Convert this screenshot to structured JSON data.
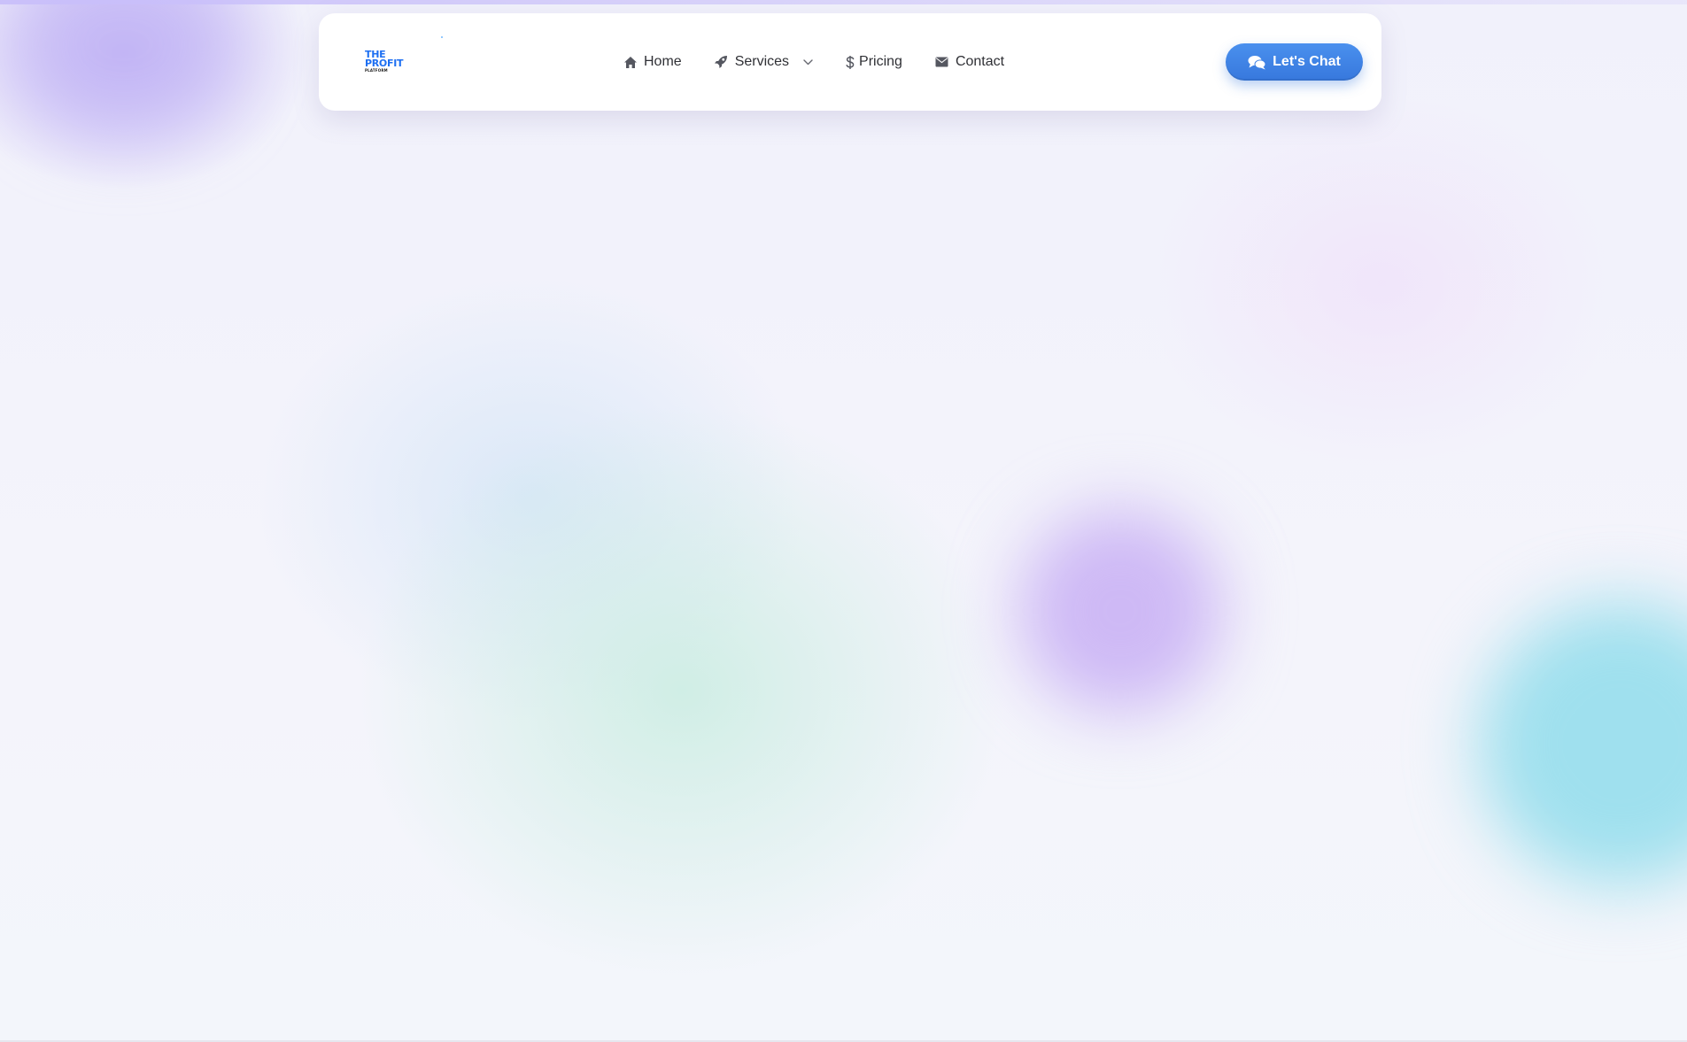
{
  "brand": {
    "logo_line1": "THE",
    "logo_line2": "PROFIT",
    "logo_line3": "PLATFORM",
    "primary_color": "#1d6ff2"
  },
  "nav": {
    "items": [
      {
        "label": "Home",
        "icon": "home-icon"
      },
      {
        "label": "Services",
        "icon": "rocket-icon",
        "has_dropdown": true
      },
      {
        "label": "Pricing",
        "icon": "dollar-icon"
      },
      {
        "label": "Contact",
        "icon": "envelope-icon"
      }
    ]
  },
  "cta": {
    "label": "Let's Chat",
    "icon": "chat-bubbles-icon",
    "color": "#3d82e6"
  }
}
